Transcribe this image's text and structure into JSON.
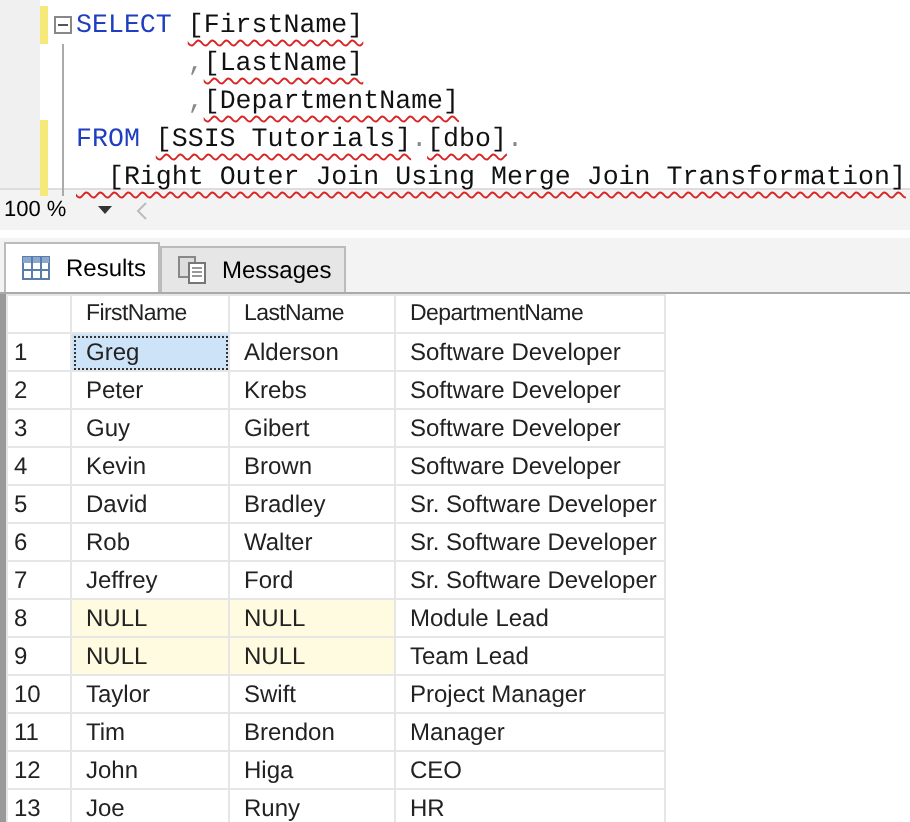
{
  "editor": {
    "lines": [
      {
        "changed": true,
        "fold": true,
        "segments": [
          {
            "text": "SELECT",
            "kind": "keyword",
            "squiggle": false
          },
          {
            "text": "[FirstName]",
            "kind": "plain",
            "squiggle": true
          }
        ]
      },
      {
        "changed": false,
        "segments": [
          {
            "text": "       ,",
            "kind": "punct",
            "squiggle": false
          },
          {
            "text": "[LastName]",
            "kind": "plain",
            "squiggle": true
          }
        ]
      },
      {
        "changed": false,
        "segments": [
          {
            "text": "       ,",
            "kind": "punct",
            "squiggle": false
          },
          {
            "text": "[DepartmentName]",
            "kind": "plain",
            "squiggle": true
          }
        ]
      },
      {
        "changed": true,
        "segments": [
          {
            "text": "FROM",
            "kind": "keyword",
            "squiggle": false
          },
          {
            "text": "[SSIS Tutorials]",
            "kind": "plain",
            "squiggle": true
          },
          {
            "text": ".",
            "kind": "punct",
            "squiggle": false
          },
          {
            "text": "[dbo]",
            "kind": "plain",
            "squiggle": true
          },
          {
            "text": ".",
            "kind": "punct",
            "squiggle": false
          }
        ]
      },
      {
        "changed": true,
        "segments": [
          {
            "text": "  [Right Outer Join Using Merge Join Transformation]",
            "kind": "plain",
            "squiggle": true
          }
        ]
      }
    ]
  },
  "zoom": {
    "value": "100 %"
  },
  "tabs": [
    {
      "label": "Results",
      "selected": true
    },
    {
      "label": "Messages",
      "selected": false
    }
  ],
  "grid": {
    "columns": [
      "FirstName",
      "LastName",
      "DepartmentName"
    ],
    "rows": [
      {
        "number": "1",
        "cells": [
          {
            "text": "Greg",
            "null": false,
            "selected": true
          },
          {
            "text": "Alderson",
            "null": false,
            "selected": false
          },
          {
            "text": "Software Developer",
            "null": false,
            "selected": false
          }
        ]
      },
      {
        "number": "2",
        "cells": [
          {
            "text": "Peter",
            "null": false,
            "selected": false
          },
          {
            "text": "Krebs",
            "null": false,
            "selected": false
          },
          {
            "text": "Software Developer",
            "null": false,
            "selected": false
          }
        ]
      },
      {
        "number": "3",
        "cells": [
          {
            "text": "Guy",
            "null": false,
            "selected": false
          },
          {
            "text": "Gibert",
            "null": false,
            "selected": false
          },
          {
            "text": "Software Developer",
            "null": false,
            "selected": false
          }
        ]
      },
      {
        "number": "4",
        "cells": [
          {
            "text": "Kevin",
            "null": false,
            "selected": false
          },
          {
            "text": "Brown",
            "null": false,
            "selected": false
          },
          {
            "text": "Software Developer",
            "null": false,
            "selected": false
          }
        ]
      },
      {
        "number": "5",
        "cells": [
          {
            "text": "David",
            "null": false,
            "selected": false
          },
          {
            "text": "Bradley",
            "null": false,
            "selected": false
          },
          {
            "text": "Sr. Software Developer",
            "null": false,
            "selected": false
          }
        ]
      },
      {
        "number": "6",
        "cells": [
          {
            "text": "Rob",
            "null": false,
            "selected": false
          },
          {
            "text": "Walter",
            "null": false,
            "selected": false
          },
          {
            "text": "Sr. Software Developer",
            "null": false,
            "selected": false
          }
        ]
      },
      {
        "number": "7",
        "cells": [
          {
            "text": "Jeffrey",
            "null": false,
            "selected": false
          },
          {
            "text": "Ford",
            "null": false,
            "selected": false
          },
          {
            "text": "Sr. Software Developer",
            "null": false,
            "selected": false
          }
        ]
      },
      {
        "number": "8",
        "cells": [
          {
            "text": "NULL",
            "null": true,
            "selected": false
          },
          {
            "text": "NULL",
            "null": true,
            "selected": false
          },
          {
            "text": "Module Lead",
            "null": false,
            "selected": false
          }
        ]
      },
      {
        "number": "9",
        "cells": [
          {
            "text": "NULL",
            "null": true,
            "selected": false
          },
          {
            "text": "NULL",
            "null": true,
            "selected": false
          },
          {
            "text": "Team Lead",
            "null": false,
            "selected": false
          }
        ]
      },
      {
        "number": "10",
        "cells": [
          {
            "text": "Taylor",
            "null": false,
            "selected": false
          },
          {
            "text": "Swift",
            "null": false,
            "selected": false
          },
          {
            "text": "Project Manager",
            "null": false,
            "selected": false
          }
        ]
      },
      {
        "number": "11",
        "cells": [
          {
            "text": "Tim",
            "null": false,
            "selected": false
          },
          {
            "text": "Brendon",
            "null": false,
            "selected": false
          },
          {
            "text": "Manager",
            "null": false,
            "selected": false
          }
        ]
      },
      {
        "number": "12",
        "cells": [
          {
            "text": "John",
            "null": false,
            "selected": false
          },
          {
            "text": "Higa",
            "null": false,
            "selected": false
          },
          {
            "text": "CEO",
            "null": false,
            "selected": false
          }
        ]
      },
      {
        "number": "13",
        "cells": [
          {
            "text": "Joe",
            "null": false,
            "selected": false
          },
          {
            "text": "Runy",
            "null": false,
            "selected": false
          },
          {
            "text": "HR",
            "null": false,
            "selected": false
          }
        ]
      }
    ]
  }
}
